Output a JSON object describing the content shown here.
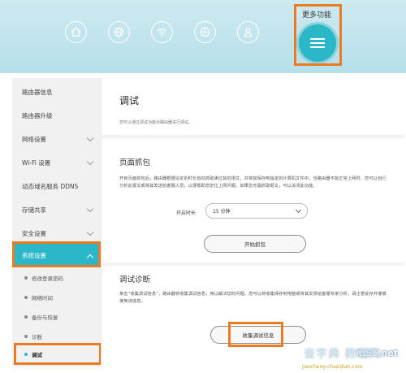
{
  "nav": {
    "icons": [
      "home-icon",
      "globe-icon",
      "wifi-icon",
      "router-icon",
      "user-icon"
    ],
    "more_label": "更多功能",
    "accent": "#2ab8c8",
    "highlight": "#ec7a20"
  },
  "sidebar": {
    "items": [
      {
        "label": "路由器信息"
      },
      {
        "label": "路由器升级"
      },
      {
        "label": "网络设置"
      },
      {
        "label": "Wi-Fi 设置"
      },
      {
        "label": "动态域名服务 DDNS"
      },
      {
        "label": "存储共享"
      },
      {
        "label": "安全设置"
      },
      {
        "label": "系统设置"
      }
    ],
    "sub_items": [
      {
        "label": "修改登录密码"
      },
      {
        "label": "网络时间"
      },
      {
        "label": "备份与恢复"
      },
      {
        "label": "诊断"
      },
      {
        "label": "调试"
      }
    ]
  },
  "main": {
    "title": "调试",
    "description": "您可以通过调试功能对路由器进行调试。",
    "capture": {
      "title": "页面抓包",
      "text": "开启页面抓包后，路由器根据设定的时长自动抓取通过其的报文，并将其保存到指定的计算机文件中。当路由器不能正常上网时，您可以自行分析此报文或将其发送给客服人员，以便帮助您定位上网问题。如果您无需抓取报文，可以关闭此功能。",
      "duration_label": "开启时长",
      "duration_value": "15 分钟",
      "start_button": "开始抓包"
    },
    "diagnose": {
      "title": "调试诊断",
      "text": "单击“收集调试信息”，路由器将收集调试信息，用以解决您的问题。您可以将收集保存到电脑或将其反馈给客服专家分析，请注意妥存并谨慎使用该信息。",
      "collect_button": "收集调试信息"
    }
  },
  "watermark": {
    "site": "ib51.net",
    "brand": "查字典 教程网",
    "url": "jiaocheng.chazidian.com"
  }
}
